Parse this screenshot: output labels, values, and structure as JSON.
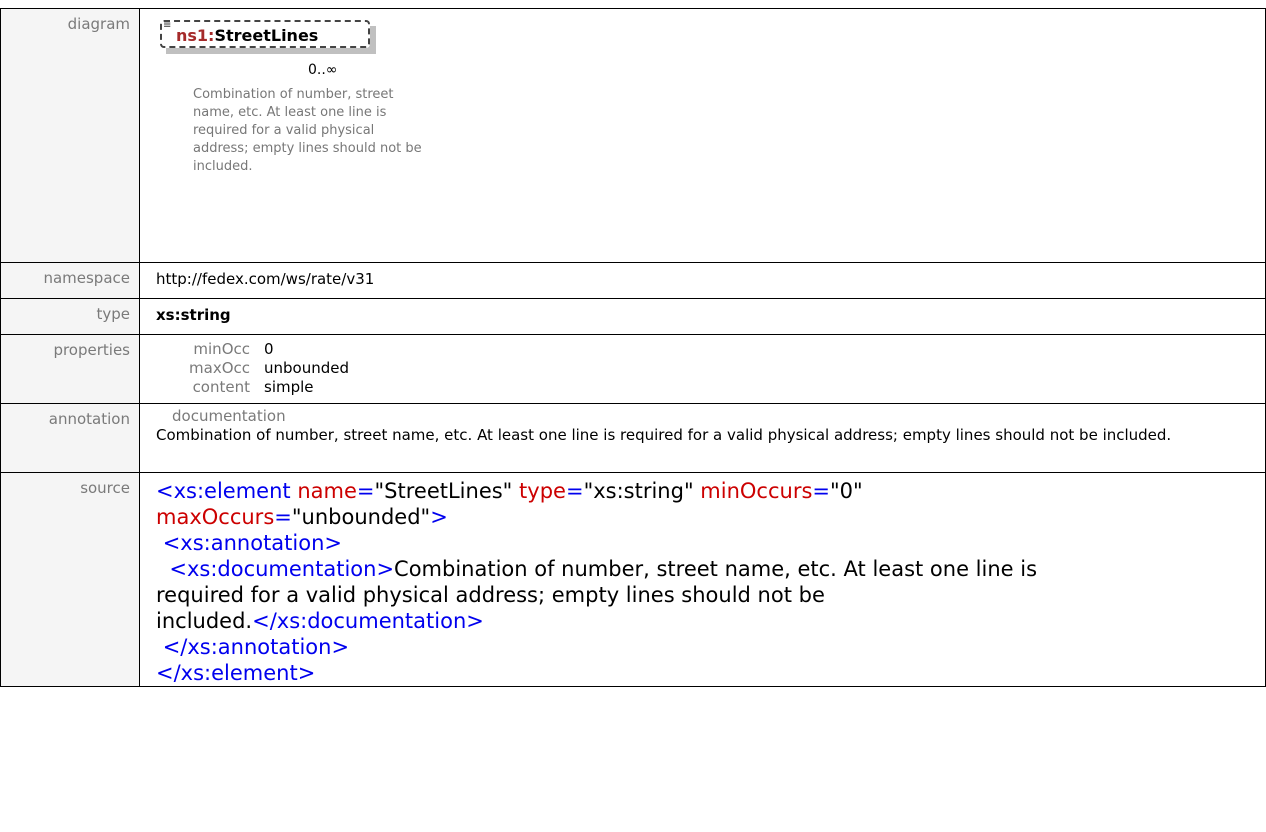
{
  "labels": {
    "diagram": "diagram",
    "namespace": "namespace",
    "type": "type",
    "properties": "properties",
    "annotation": "annotation",
    "source": "source"
  },
  "diagram": {
    "prefix": "ns1:",
    "element_name": "StreetLines",
    "lines_icon": "≡",
    "occurrence": "0..∞",
    "description": "Combination of number, street name, etc. At least one line is required for a valid physical address; empty lines should not be included."
  },
  "namespace": "http://fedex.com/ws/rate/v31",
  "type": "xs:string",
  "properties": [
    {
      "key": "minOcc",
      "value": "0"
    },
    {
      "key": "maxOcc",
      "value": "unbounded"
    },
    {
      "key": "content",
      "value": "simple"
    }
  ],
  "annotation": {
    "key": "documentation",
    "text": "Combination of number, street name, etc. At least one line is required for a valid physical address; empty lines should not be included."
  },
  "source": {
    "line1_tag": "<xs:element",
    "attr_name": "name",
    "val_name": "\"StreetLines\"",
    "attr_type": "type",
    "val_type": "\"xs:string\"",
    "attr_min": "minOccurs",
    "val_min": "\"0\"",
    "attr_max": "maxOccurs",
    "val_max": "\"unbounded\"",
    "close1": ">",
    "ann_open": "<xs:annotation>",
    "doc_open": "<xs:documentation>",
    "doc_text_1": "Combination of number, street name, etc. At least one line is",
    "doc_text_2": "required for a valid physical address; empty lines should not be",
    "doc_text_3": "included.",
    "doc_close": "</xs:documentation>",
    "ann_close": "</xs:annotation>",
    "el_close": "</xs:element>"
  }
}
